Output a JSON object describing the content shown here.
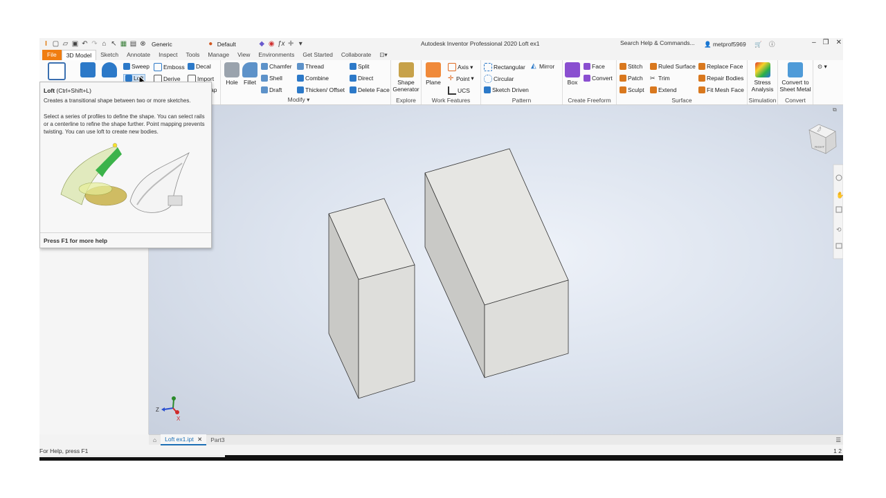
{
  "titlebar": {
    "app_title": "Autodesk Inventor Professional 2020   Loft ex1",
    "search_placeholder": "Search Help & Commands...",
    "user": "metprof5969",
    "material_select": "Generic",
    "appearance_select": "Default"
  },
  "menu_tabs": [
    "File",
    "3D Model",
    "Sketch",
    "Annotate",
    "Inspect",
    "Tools",
    "Manage",
    "View",
    "Environments",
    "Get Started",
    "Collaborate"
  ],
  "ribbon": {
    "create": {
      "sweep": "Sweep",
      "emboss": "Emboss",
      "decal": "Decal",
      "loft": "Loft",
      "derive": "Derive",
      "import": "Import",
      "unwrap_partial": "ap"
    },
    "modify": {
      "label": "Modify",
      "hole": "Hole",
      "fillet": "Fillet",
      "chamfer": "Chamfer",
      "shell": "Shell",
      "draft": "Draft",
      "thread": "Thread",
      "combine": "Combine",
      "thicken": "Thicken/ Offset",
      "split": "Split",
      "direct": "Direct",
      "delete_face": "Delete Face"
    },
    "explore": {
      "label": "Explore",
      "shape_generator_1": "Shape",
      "shape_generator_2": "Generator"
    },
    "work_features": {
      "label": "Work Features",
      "plane": "Plane",
      "axis": "Axis",
      "point": "Point",
      "ucs": "UCS"
    },
    "pattern": {
      "label": "Pattern",
      "rectangular": "Rectangular",
      "mirror": "Mirror",
      "circular": "Circular",
      "sketch_driven": "Sketch Driven"
    },
    "freeform": {
      "label": "Create Freeform",
      "box": "Box",
      "face": "Face",
      "convert": "Convert"
    },
    "surface": {
      "label": "Surface",
      "stitch": "Stitch",
      "patch": "Patch",
      "sculpt": "Sculpt",
      "ruled_surface": "Ruled Surface",
      "trim": "Trim",
      "extend": "Extend",
      "replace_face": "Replace Face",
      "repair_bodies": "Repair Bodies",
      "fit_mesh_face": "Fit Mesh Face"
    },
    "simulation": {
      "label": "Simulation",
      "stress_1": "Stress",
      "stress_2": "Analysis"
    },
    "convert": {
      "label": "Convert",
      "convert_1": "Convert to",
      "convert_2": "Sheet Metal"
    }
  },
  "tooltip": {
    "title": "Loft",
    "shortcut": "(Ctrl+Shift+L)",
    "line1": "Creates a transitional shape between two or more sketches.",
    "line2": "Select a series of profiles to define the shape. You can select rails",
    "line3": "or a centerline to refine the shape further. Point mapping prevents",
    "line4": "twisting. You can use loft to create new bodies.",
    "footer": "Press F1 for more help"
  },
  "viewcube": {
    "face_top": "TOP",
    "face_right": "RIGHT"
  },
  "triad": {
    "z": "Z",
    "x": "X"
  },
  "doc_tabs": [
    "Loft ex1.ipt",
    "Part3"
  ],
  "status": {
    "help": "For Help, press F1",
    "right": "1  2"
  },
  "colors": {
    "file_tab": "#f07d10",
    "accent": "#1b6fb5",
    "box_face_front": "#dededb",
    "box_face_side": "#c9c9c6",
    "box_face_top": "#e6e6e3"
  }
}
